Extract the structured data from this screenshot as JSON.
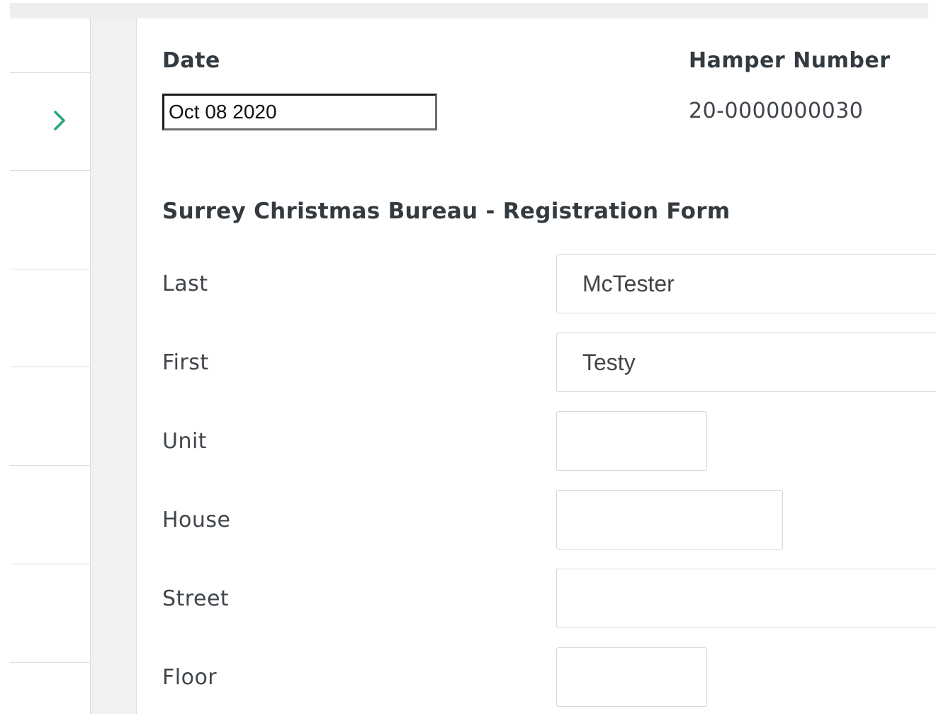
{
  "header": {
    "date_label": "Date",
    "date_value": "Oct 08 2020",
    "hamper_label": "Hamper Number",
    "hamper_value": "20-0000000030"
  },
  "form": {
    "title": "Surrey Christmas Bureau - Registration Form",
    "fields": [
      {
        "label": "Last",
        "value": "McTester"
      },
      {
        "label": "First",
        "value": "Testy"
      },
      {
        "label": "Unit",
        "value": ""
      },
      {
        "label": "House",
        "value": ""
      },
      {
        "label": "Street",
        "value": ""
      },
      {
        "label": "Floor",
        "value": ""
      }
    ]
  },
  "icons": {
    "expand": "chevron-right-icon"
  },
  "colors": {
    "accent": "#21a67a",
    "text": "#333a40",
    "border": "#d7d7d7"
  }
}
